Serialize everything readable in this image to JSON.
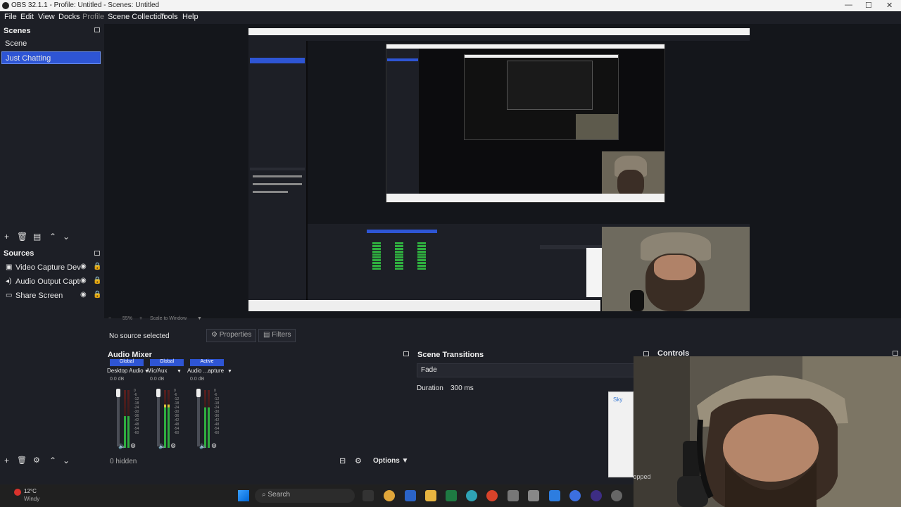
{
  "window": {
    "title": "OBS 32.1.1 - Profile: Untitled - Scenes: Untitled"
  },
  "menu": [
    "File",
    "Edit",
    "View",
    "Docks",
    "Profile",
    "Scene Collection",
    "Tools",
    "Help"
  ],
  "scenes": {
    "title": "Scenes",
    "items": [
      "Scene",
      "Just Chatting"
    ],
    "selected": 1
  },
  "sources": {
    "title": "Sources",
    "items": [
      {
        "label": "Video Capture Device",
        "icon": "camera-icon"
      },
      {
        "label": "Audio Output Capture",
        "icon": "speaker-icon"
      },
      {
        "label": "Share Screen",
        "icon": "monitor-icon"
      }
    ]
  },
  "zoom": {
    "value": "55%",
    "scale_label": "Scale to Window"
  },
  "context": {
    "no_source": "No source selected",
    "properties": "Properties",
    "filters": "Filters"
  },
  "audio_mixer": {
    "title": "Audio Mixer",
    "channels": [
      {
        "tag": "Global",
        "name": "Desktop Audio",
        "db": "0.0 dB",
        "level": 0.55
      },
      {
        "tag": "Global",
        "name": "Mic/Aux",
        "db": "0.0 dB",
        "level": 0.75
      },
      {
        "tag": "Active",
        "name": "Audio ...apture",
        "db": "0.0 dB",
        "level": 0.7
      }
    ],
    "scale": [
      "0",
      "-6",
      "-12",
      "-18",
      "-24",
      "-30",
      "-36",
      "-42",
      "-48",
      "-54",
      "-60"
    ],
    "hidden": "0 hidden",
    "options": "Options"
  },
  "scene_transitions": {
    "title": "Scene Transitions",
    "type": "Fade",
    "duration_label": "Duration",
    "duration": "300 ms"
  },
  "controls": {
    "title": "Controls"
  },
  "taskbar": {
    "weather_temp": "12°C",
    "weather_desc": "Windy",
    "search": "Search"
  },
  "overlay": {
    "skype_label": "Sky",
    "dropped": "Dropped"
  },
  "colors": {
    "accent": "#2e55d4",
    "bg": "#1d1f26"
  }
}
